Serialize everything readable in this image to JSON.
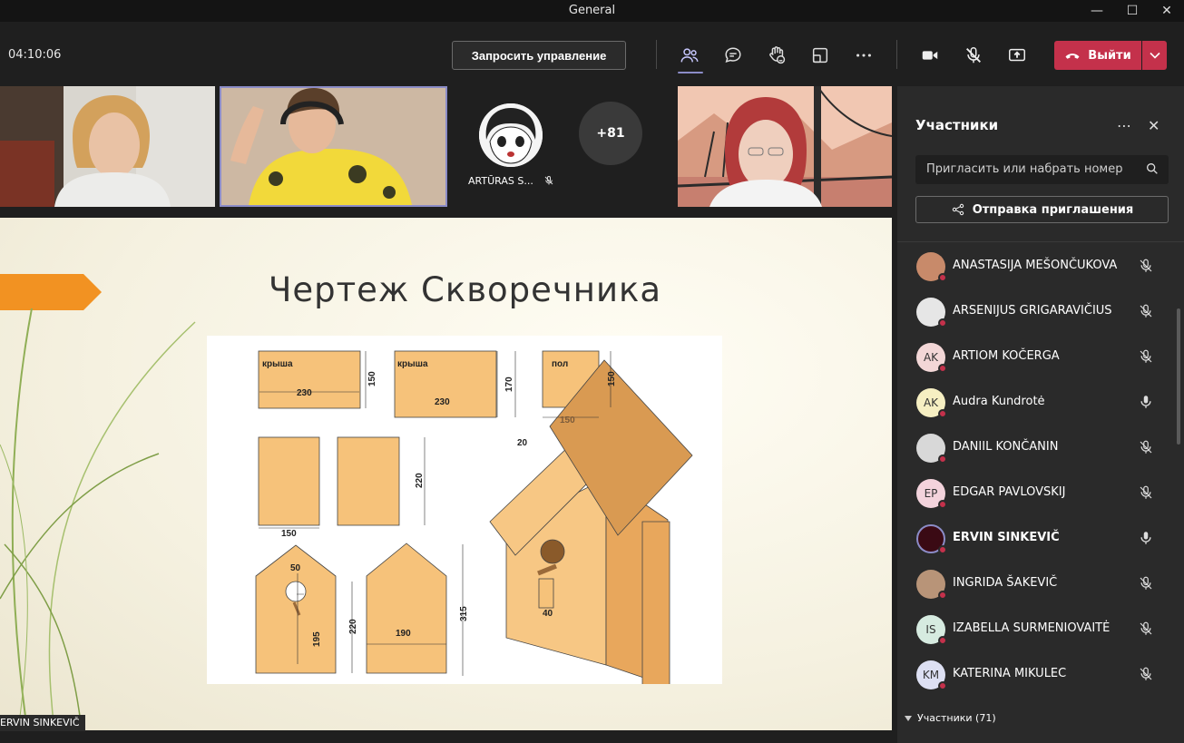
{
  "window": {
    "title": "General"
  },
  "meeting": {
    "timer": "04:10:06",
    "request_control_label": "Запросить управление",
    "leave_label": "Выйти"
  },
  "video_strip": {
    "participant_label": "ARTŪRAS S...",
    "overflow_count": "+81"
  },
  "slide": {
    "title": "Чертеж Скворечника",
    "drawing_labels": [
      "крыша",
      "230",
      "150",
      "крыша",
      "230",
      "170",
      "пол",
      "150",
      "150",
      "220",
      "150",
      "50",
      "195",
      "220",
      "190",
      "315",
      "20",
      "40"
    ]
  },
  "share_label": "ERVIN SINKEVIČ",
  "panel": {
    "title": "Участники",
    "search_placeholder": "Пригласить или набрать номер",
    "share_invite_label": "Отправка приглашения",
    "section_label": "Участники (71)",
    "participants": [
      {
        "name": "ANASTASIJA MEŠONČUKOVA",
        "initials": "",
        "avatar_color": "#c88a6a",
        "muted": true
      },
      {
        "name": "ARSENIJUS GRIGARAVIČIUS",
        "initials": "",
        "avatar_color": "#e6e6e6",
        "muted": true
      },
      {
        "name": "ARTIOM KOČERGA",
        "initials": "AK",
        "avatar_color": "#f3d7d7",
        "muted": true
      },
      {
        "name": "Audra Kundrotė",
        "initials": "AK",
        "avatar_color": "#f6efc2",
        "muted": false
      },
      {
        "name": "DANIIL KONČANIN",
        "initials": "",
        "avatar_color": "#d8d8d8",
        "muted": true
      },
      {
        "name": "EDGAR PAVLOVSKIJ",
        "initials": "EP",
        "avatar_color": "#f3d3dc",
        "muted": true
      },
      {
        "name": "ERVIN SINKEVIČ",
        "initials": "",
        "avatar_color": "#3a0a14",
        "muted": false
      },
      {
        "name": "INGRIDA ŠAKEVIČ",
        "initials": "",
        "avatar_color": "#b89478",
        "muted": true
      },
      {
        "name": "IZABELLA SURMENIOVAITĖ",
        "initials": "IS",
        "avatar_color": "#d6ebe0",
        "muted": true
      },
      {
        "name": "KATERINA MIKULEC",
        "initials": "KM",
        "avatar_color": "#dde0f3",
        "muted": true
      }
    ]
  },
  "colors": {
    "accent": "#8b8cc7",
    "leave": "#c4314b",
    "wood": "#f6c27a"
  }
}
